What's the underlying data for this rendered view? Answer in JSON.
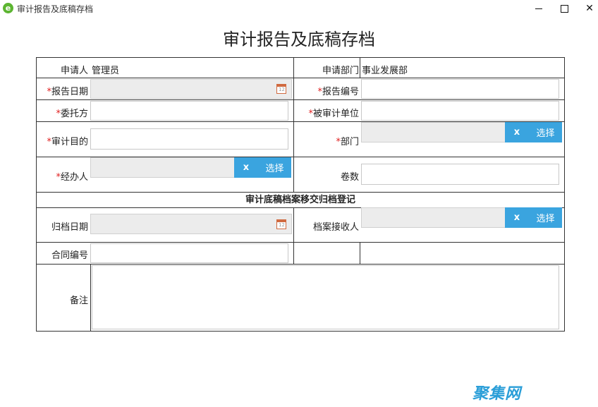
{
  "window": {
    "title": "审计报告及底稿存档"
  },
  "form": {
    "title": "审计报告及底稿存档",
    "applicant_label": "申请人",
    "applicant_value": "管理员",
    "apply_dept_label": "申请部门",
    "apply_dept_value": "事业发展部",
    "report_date_label": "报告日期",
    "report_no_label": "报告编号",
    "client_label": "委托方",
    "audited_unit_label": "被审计单位",
    "purpose_label": "审计目的",
    "dept_label": "部门",
    "handler_label": "经办人",
    "volumes_label": "卷数",
    "section_title": "审计底稿档案移交归档登记",
    "archive_date_label": "归档日期",
    "receiver_label": "档案接收人",
    "contract_no_label": "合同编号",
    "remarks_label": "备注",
    "required_mark": "*",
    "clear_label": "x",
    "choose_label": "选择",
    "calendar_day": "12"
  },
  "watermark": "聚集网",
  "colors": {
    "accent": "#3aa4df",
    "required": "#e02020",
    "disabled_bg": "#ececec"
  }
}
